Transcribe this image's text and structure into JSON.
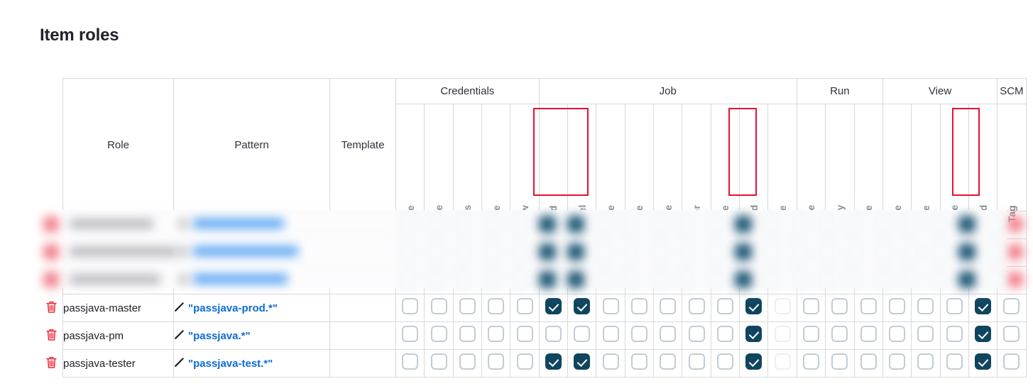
{
  "page": {
    "title": "Item roles"
  },
  "table": {
    "fixed_headers": [
      "Role",
      "Pattern",
      "Template"
    ],
    "groups": [
      {
        "label": "Credentials",
        "columns": [
          "Create",
          "Delete",
          "ManageDomains",
          "Update",
          "View"
        ]
      },
      {
        "label": "Job",
        "columns": [
          "Build",
          "Cancel",
          "Configure",
          "Create",
          "Delete",
          "Discover",
          "Move",
          "Read",
          "Workspace"
        ]
      },
      {
        "label": "Run",
        "columns": [
          "Delete",
          "Replay",
          "Update"
        ]
      },
      {
        "label": "View",
        "columns": [
          "Configure",
          "Create",
          "Delete",
          "Read"
        ]
      },
      {
        "label": "SCM",
        "columns": [
          "Tag"
        ]
      }
    ],
    "rows": [
      {
        "role": "passjava-master",
        "pattern": "\"passjava-prod.*\"",
        "template": "",
        "checks": [
          false,
          false,
          false,
          false,
          false,
          true,
          true,
          false,
          false,
          false,
          false,
          false,
          true,
          false,
          false,
          false,
          false,
          false,
          false,
          false,
          true,
          false
        ]
      },
      {
        "role": "passjava-pm",
        "pattern": "\"passjava.*\"",
        "template": "",
        "checks": [
          false,
          false,
          false,
          false,
          false,
          false,
          false,
          false,
          false,
          false,
          false,
          false,
          true,
          false,
          false,
          false,
          false,
          false,
          false,
          false,
          true,
          false
        ]
      },
      {
        "role": "passjava-tester",
        "pattern": "\"passjava-test.*\"",
        "template": "",
        "checks": [
          false,
          false,
          false,
          false,
          false,
          true,
          true,
          false,
          false,
          false,
          false,
          false,
          true,
          false,
          false,
          false,
          false,
          false,
          false,
          false,
          true,
          false
        ]
      }
    ],
    "redacted_row_count": 3,
    "highlights": [
      {
        "group": "Job",
        "columns": [
          "Build",
          "Cancel"
        ]
      },
      {
        "group": "Job",
        "columns": [
          "Read"
        ]
      },
      {
        "group": "View",
        "columns": [
          "Read"
        ]
      }
    ]
  },
  "icons": {
    "delete_row": "trash-icon",
    "edit_pattern": "pencil-icon"
  },
  "colors": {
    "checkbox_checked": "#10455f",
    "checkbox_border": "#c3ccd4",
    "pattern_link": "#0b6cd4",
    "trash": "#ed2939",
    "highlight_outline": "#e8112d",
    "header_background": "#f4f4f8"
  }
}
